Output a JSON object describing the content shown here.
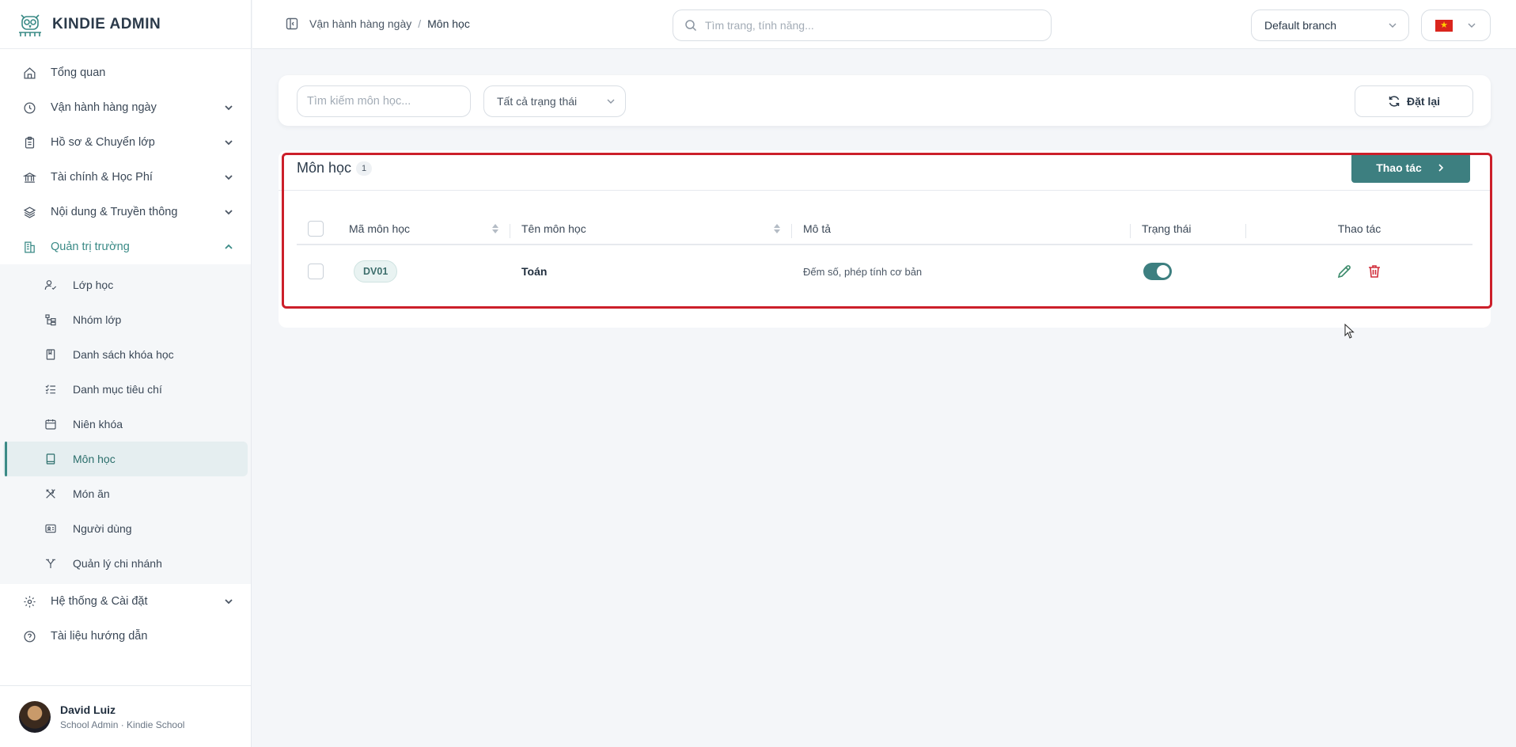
{
  "app": {
    "brand": "KINDIE ADMIN"
  },
  "sidebar": {
    "items": [
      {
        "label": "Tổng quan",
        "icon": "home-icon"
      },
      {
        "label": "Vận hành hàng ngày",
        "icon": "clock-icon"
      },
      {
        "label": "Hồ sơ & Chuyển lớp",
        "icon": "clipboard-icon"
      },
      {
        "label": "Tài chính & Học Phí",
        "icon": "bank-icon"
      },
      {
        "label": "Nội dung & Truyền thông",
        "icon": "layers-icon"
      },
      {
        "label": "Quản trị trường",
        "icon": "building-icon"
      }
    ],
    "sub_items": [
      {
        "label": "Lớp học",
        "icon": "user-check-icon"
      },
      {
        "label": "Nhóm lớp",
        "icon": "tree-icon"
      },
      {
        "label": "Danh sách khóa học",
        "icon": "book-icon"
      },
      {
        "label": "Danh mục tiêu chí",
        "icon": "checklist-icon"
      },
      {
        "label": "Niên khóa",
        "icon": "calendar-icon"
      },
      {
        "label": "Môn học",
        "icon": "notebook-icon"
      },
      {
        "label": "Món ăn",
        "icon": "utensils-icon"
      },
      {
        "label": "Người dùng",
        "icon": "id-card-icon"
      },
      {
        "label": "Quản lý chi nhánh",
        "icon": "branch-icon"
      }
    ],
    "bottom_items": [
      {
        "label": "Hệ thống & Cài đặt",
        "icon": "gear-icon"
      },
      {
        "label": "Tài liệu hướng dẫn",
        "icon": "help-icon"
      }
    ],
    "user": {
      "name": "David Luiz",
      "role": "School Admin · Kindie School"
    }
  },
  "topbar": {
    "breadcrumb": {
      "parent": "Vận hành hàng ngày",
      "separator": "/",
      "current": "Môn học"
    },
    "search_placeholder": "Tìm trang, tính năng...",
    "branch": "Default branch"
  },
  "filters": {
    "search_placeholder": "Tìm kiếm môn học...",
    "status_value": "Tất cả trạng thái",
    "reset_label": "Đặt lại"
  },
  "card": {
    "title": "Môn học",
    "count": "1",
    "action_label": "Thao tác",
    "columns": {
      "code": "Mã môn học",
      "name": "Tên môn học",
      "desc": "Mô tả",
      "status": "Trạng thái",
      "actions": "Thao tác"
    },
    "rows": [
      {
        "code": "DV01",
        "name": "Toán",
        "desc": "Đếm số, phép tính cơ bản",
        "status_on": true
      }
    ]
  },
  "colors": {
    "accent": "#3d7f80",
    "highlight": "#cc1f2a",
    "delete": "#d12e3b"
  }
}
